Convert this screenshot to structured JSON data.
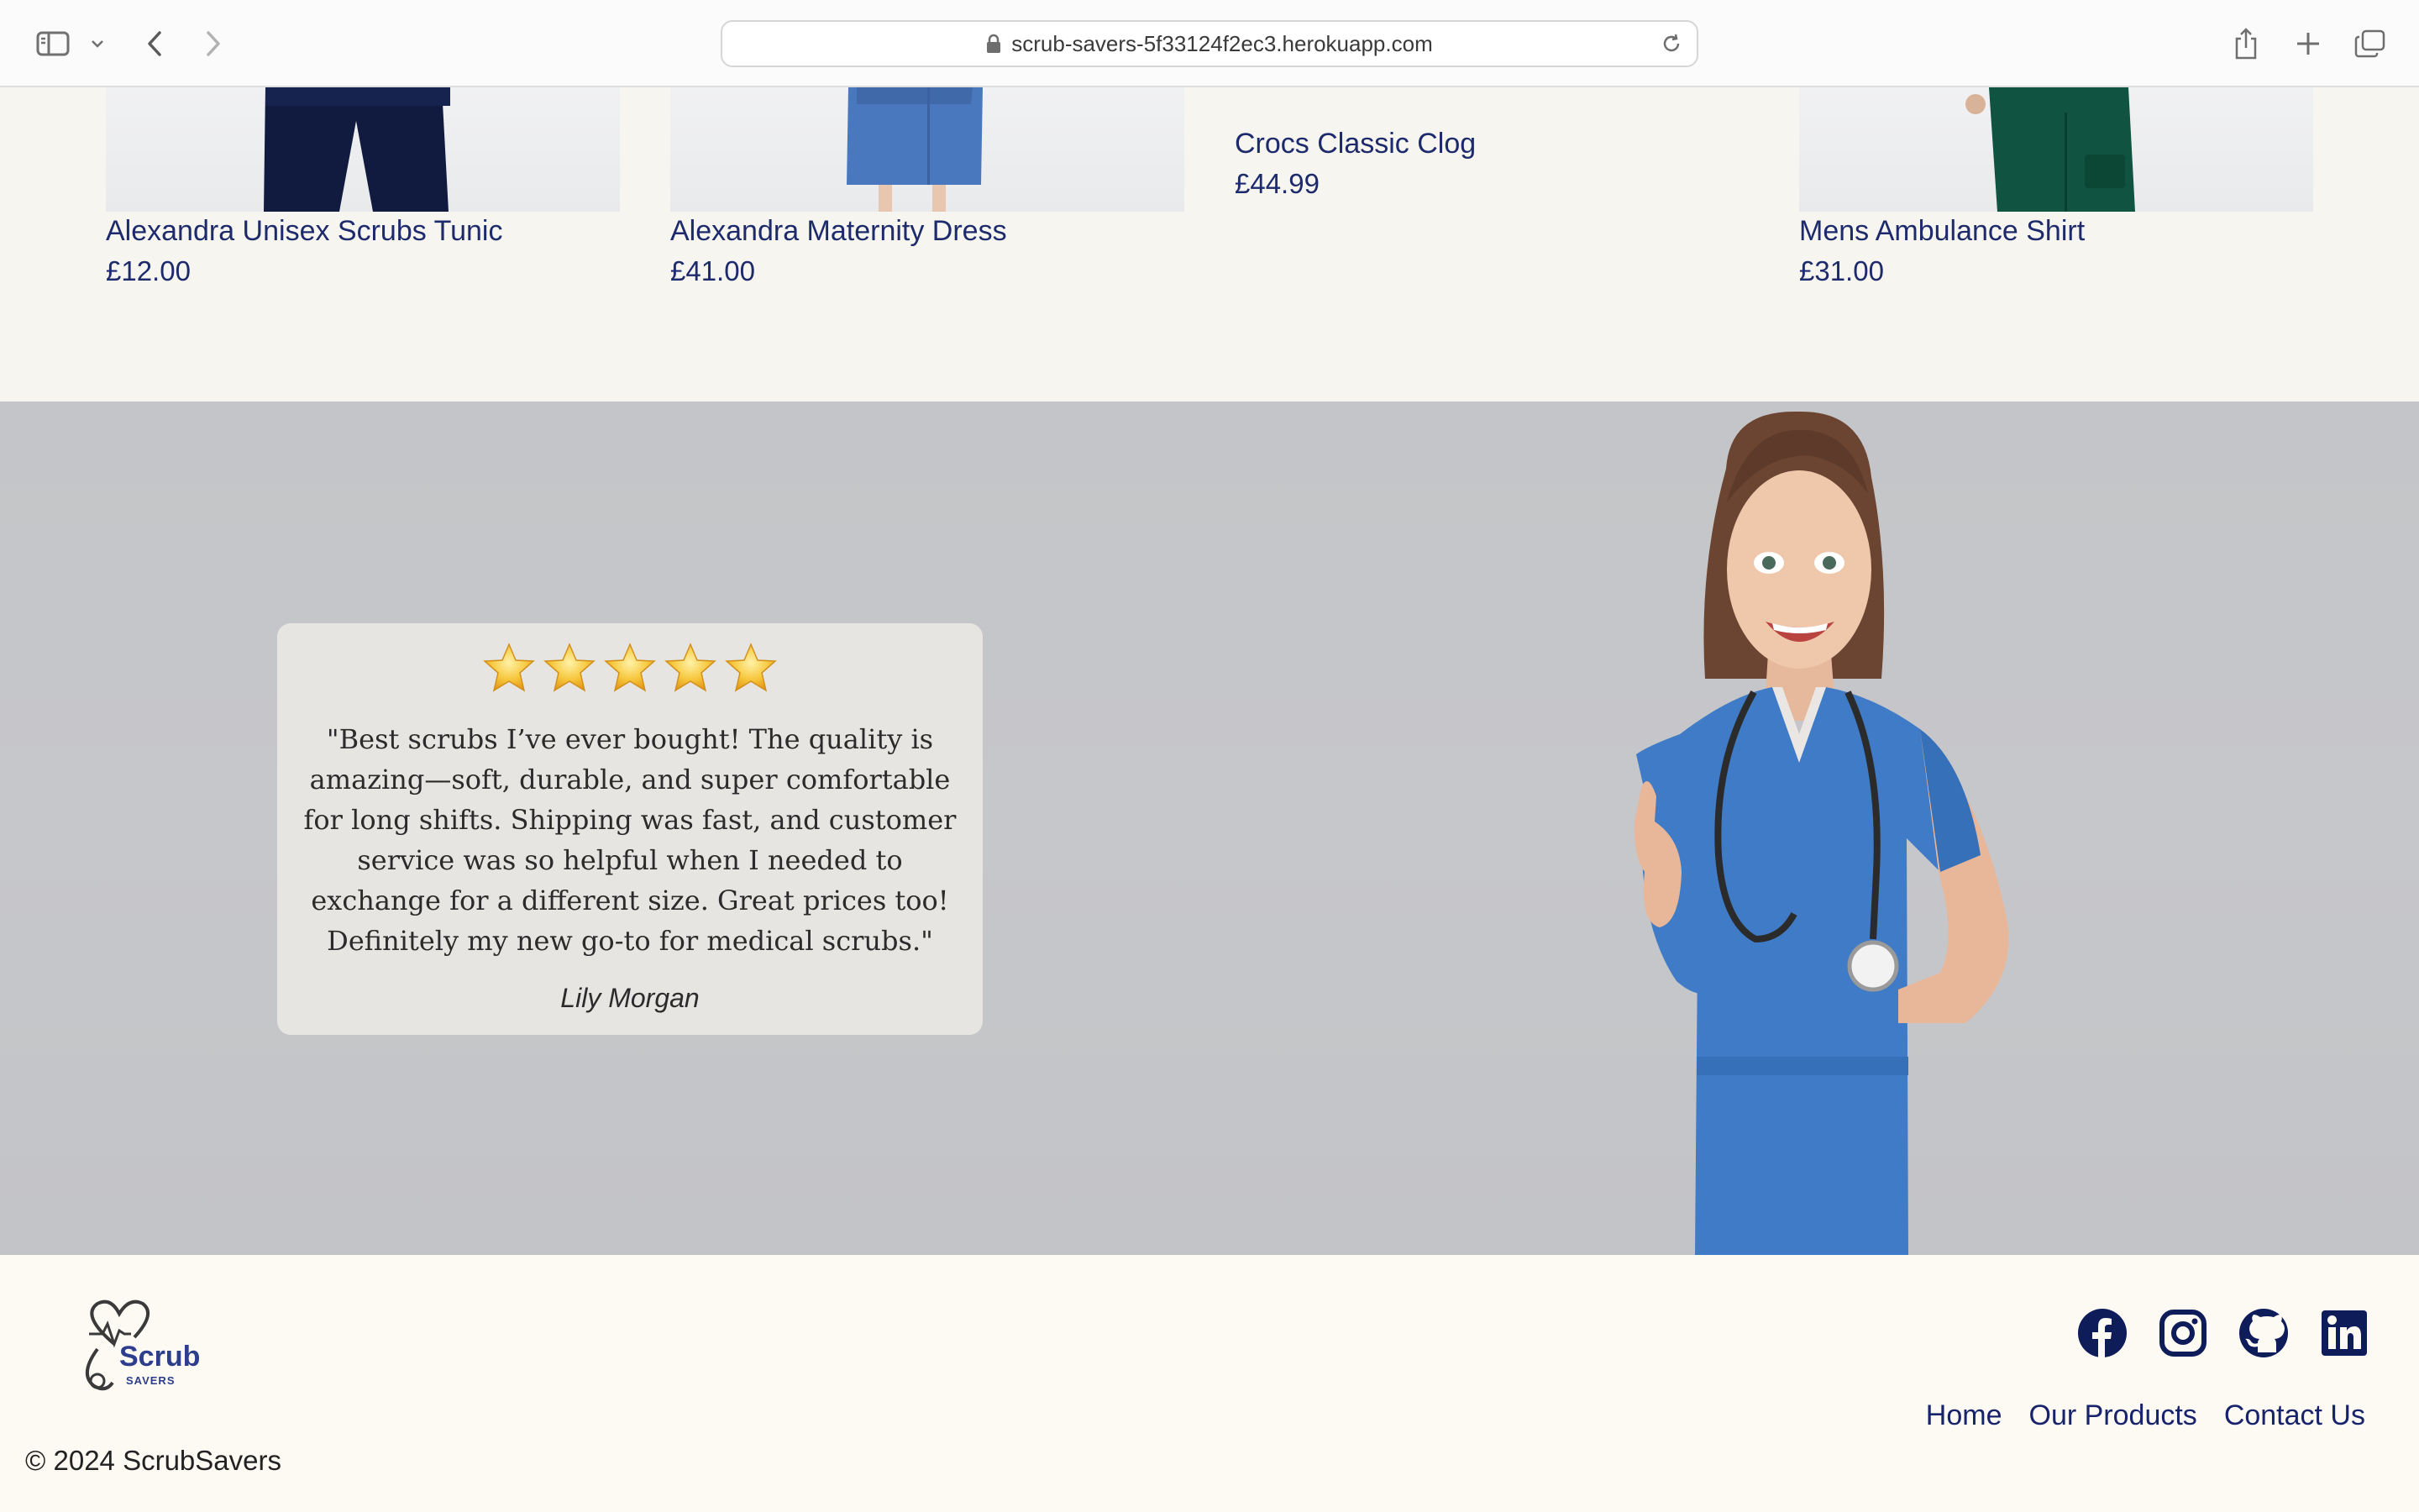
{
  "browser": {
    "url": "scrub-savers-5f33124f2ec3.herokuapp.com",
    "icons": [
      "sidebar-icon",
      "chevron-down-icon",
      "back-icon",
      "forward-icon",
      "lock-icon",
      "reload-icon",
      "share-icon",
      "plus-icon",
      "tabs-icon"
    ]
  },
  "products": [
    {
      "name": "Alexandra Unisex Scrubs Tunic",
      "price": "£12.00"
    },
    {
      "name": "Alexandra Maternity Dress",
      "price": "£41.00"
    },
    {
      "name": "Crocs Classic Clog",
      "price": "£44.99"
    },
    {
      "name": "Mens Ambulance Shirt",
      "price": "£31.00"
    }
  ],
  "testimonial": {
    "rating": 5,
    "max_rating": 5,
    "quote": "\"Best scrubs I’ve ever bought! The quality is amazing—soft, durable, and super comfortable for long shifts. Shipping was fast, and customer service was so helpful when I needed to exchange for a different size. Great prices too! Definitely my new go-to for medical scrubs.\"",
    "author": "Lily Morgan"
  },
  "footer": {
    "logo": {
      "word": "Scrub",
      "sub": "SAVERS"
    },
    "socials": [
      "facebook-icon",
      "instagram-icon",
      "github-icon",
      "linkedin-icon"
    ],
    "nav": [
      "Home",
      "Our Products",
      "Contact Us"
    ],
    "copyright": "© 2024 ScrubSavers"
  },
  "colors": {
    "brand_navy": "#1d2a6b",
    "hero_bg": "#c5c6c9",
    "footer_bg": "#fdf9f3",
    "page_bg": "#f7f5f0",
    "star_gold": "#f5c242"
  }
}
